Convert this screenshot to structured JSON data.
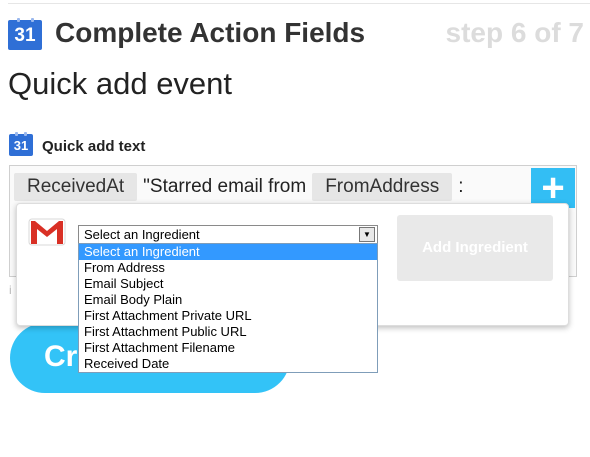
{
  "header": {
    "icon_day": "31",
    "title": "Complete Action Fields",
    "step": "step 6 of 7"
  },
  "page_title": "Quick add event",
  "field": {
    "icon_day": "31",
    "label": "Quick add text",
    "tokens": {
      "t1": "ReceivedAt",
      "t2": "\"Starred email from",
      "t3": "FromAddress",
      "t4": ":"
    },
    "add_button": "+",
    "fragment": "i"
  },
  "create_button": {
    "label": "Cr"
  },
  "ingredient_popup": {
    "service_icon": "gmail-icon",
    "select_value": "Select an Ingredient",
    "options": [
      "Select an Ingredient",
      "From Address",
      "Email Subject",
      "Email Body Plain",
      "First Attachment Private URL",
      "First Attachment Public URL",
      "First Attachment Filename",
      "Received Date"
    ],
    "add_ingredient": "Add Ingredient"
  },
  "colors": {
    "calendar_blue": "#2f6fd6",
    "accent": "#33bef4",
    "selected_option": "#3399ff"
  }
}
